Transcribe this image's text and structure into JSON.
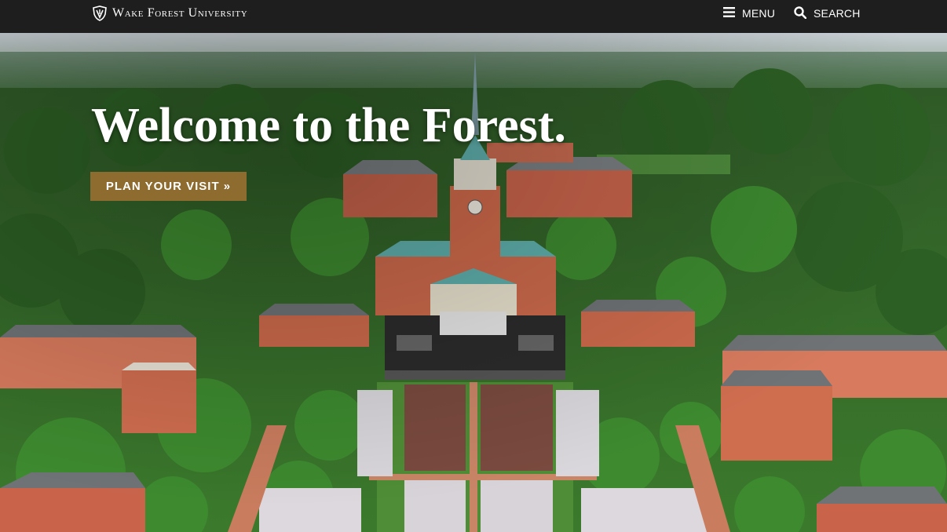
{
  "header": {
    "brand_name": "Wake Forest University",
    "menu_label": "MENU",
    "search_label": "SEARCH"
  },
  "hero": {
    "headline": "Welcome to the Forest.",
    "cta_label": "PLAN YOUR VISIT »"
  },
  "colors": {
    "topbar": "#1e1e1e",
    "cta_gold": "#8e6b2e",
    "text": "#ffffff"
  },
  "icons": {
    "logo": "shield-logo-icon",
    "menu": "hamburger-menu-icon",
    "search": "search-icon"
  }
}
